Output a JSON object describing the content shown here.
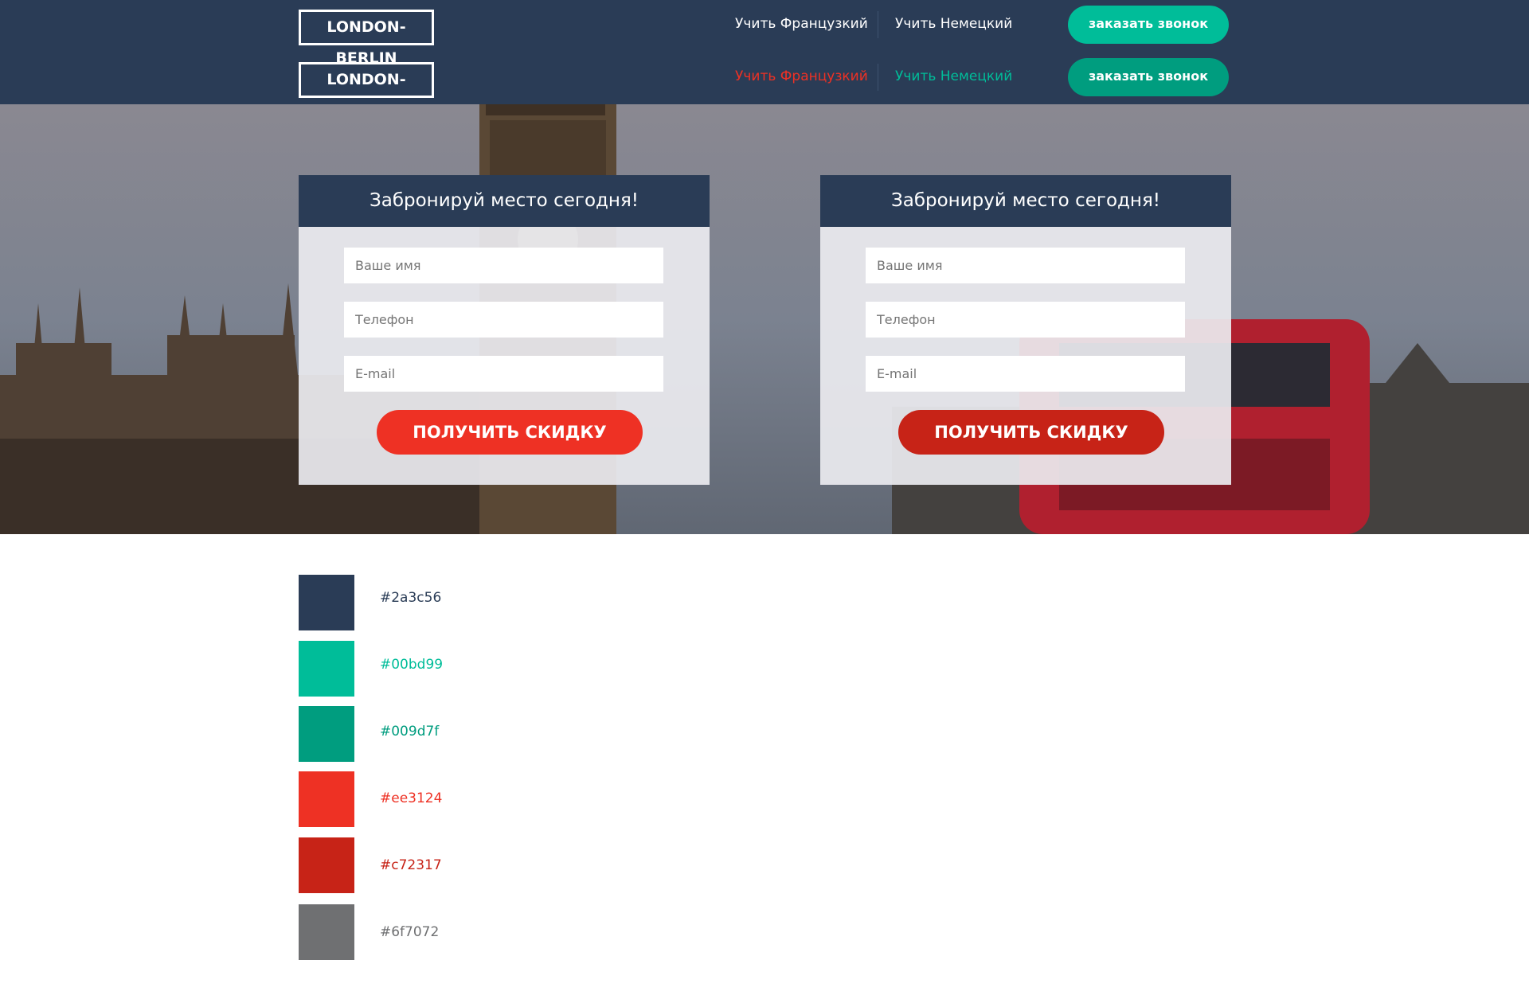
{
  "header": {
    "logo_text": "LONDON-BERLIN",
    "rows": [
      {
        "link_french": "Учить Французкий",
        "link_german": "Учить Немецкий",
        "call_button": "заказать звонок"
      },
      {
        "link_french": "Учить Французкий",
        "link_german": "Учить Немецкий",
        "call_button": "заказать звонок"
      }
    ]
  },
  "forms": [
    {
      "title": "Забронируй место сегодня!",
      "name_placeholder": "Ваше имя",
      "phone_placeholder": "Телефон",
      "email_placeholder": "E-mail",
      "submit_label": "ПОЛУЧИТЬ СКИДКУ"
    },
    {
      "title": "Забронируй место сегодня!",
      "name_placeholder": "Ваше имя",
      "phone_placeholder": "Телефон",
      "email_placeholder": "E-mail",
      "submit_label": "ПОЛУЧИТЬ СКИДКУ"
    }
  ],
  "palette": [
    {
      "hex": "#2a3c56"
    },
    {
      "hex": "#00bd99"
    },
    {
      "hex": "#009d7f"
    },
    {
      "hex": "#ee3124"
    },
    {
      "hex": "#c72317"
    },
    {
      "hex": "#6f7072"
    }
  ]
}
